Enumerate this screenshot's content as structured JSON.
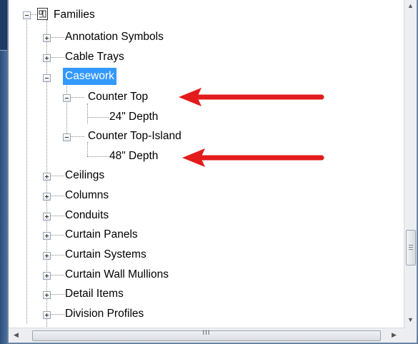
{
  "tree": {
    "root_label": "Families",
    "items": [
      {
        "label": "Annotation Symbols"
      },
      {
        "label": "Cable Trays"
      },
      {
        "label": "Casework"
      },
      {
        "label": "Counter Top"
      },
      {
        "label": "24\" Depth"
      },
      {
        "label": "Counter Top-Island"
      },
      {
        "label": "48\" Depth"
      },
      {
        "label": "Ceilings"
      },
      {
        "label": "Columns"
      },
      {
        "label": "Conduits"
      },
      {
        "label": "Curtain Panels"
      },
      {
        "label": "Curtain Systems"
      },
      {
        "label": "Curtain Wall Mullions"
      },
      {
        "label": "Detail Items"
      },
      {
        "label": "Division Profiles"
      }
    ],
    "selected": "Casework"
  },
  "scrollbars": {
    "horizontal_grip": "III",
    "left_arrow": "◀",
    "right_arrow": "▶",
    "up_arrow": "▲",
    "down_arrow": "▼"
  },
  "colors": {
    "selection": "#3399ff",
    "annotation_arrow": "#e31b1b"
  },
  "icons": [
    "families-icon",
    "expand-icon",
    "collapse-icon",
    "annotation-arrow"
  ]
}
